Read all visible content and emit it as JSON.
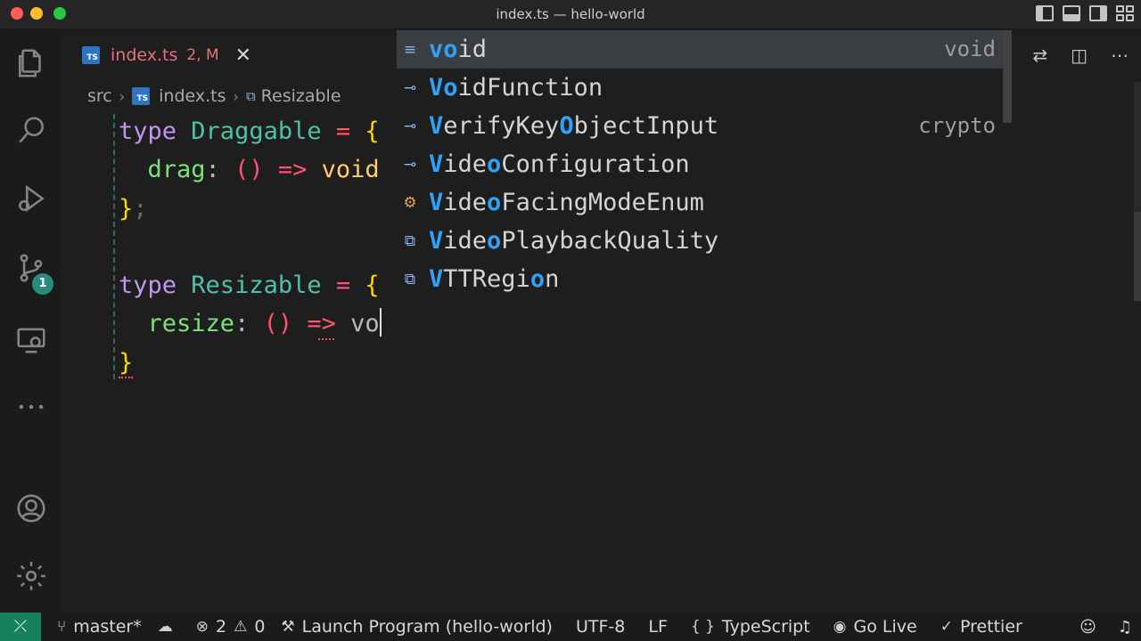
{
  "window": {
    "title": "index.ts — hello-world"
  },
  "tab": {
    "filename": "index.ts",
    "status": "2, M",
    "close_glyph": "✕",
    "icon_text": "TS"
  },
  "breadcrumb": {
    "folder": "src",
    "file": "index.ts",
    "symbol": "Resizable",
    "file_icon_text": "TS"
  },
  "activity": {
    "source_control_badge": "1"
  },
  "code": {
    "line1": {
      "kw": "type",
      "name": "Draggable",
      "eq": "=",
      "brace": "{"
    },
    "line2": {
      "prop": "drag",
      "colon": ":",
      "parens": "()",
      "arrow": "=>",
      "ret": "void"
    },
    "line3": {
      "brace": "}",
      "semi": ";"
    },
    "line5": {
      "kw": "type",
      "name": "Resizable",
      "eq": "=",
      "brace": "{"
    },
    "line6": {
      "prop": "resize",
      "colon": ":",
      "parens": "()",
      "arrow": "=>",
      "typed": "vo"
    },
    "line7": {
      "brace": "}"
    }
  },
  "suggestions": [
    {
      "hl1": "vo",
      "rest": "id",
      "detail": "void",
      "icon": "keyword-icon",
      "glyph": "≡"
    },
    {
      "hl1": "Vo",
      "rest": "idFunction",
      "detail": "",
      "icon": "interface-icon",
      "glyph": "⊸"
    },
    {
      "pre": "",
      "hl1": "V",
      "mid": "erifyKey",
      "hl2": "O",
      "rest": "bjectInput",
      "detail": "crypto",
      "icon": "interface-icon",
      "glyph": "⊸"
    },
    {
      "hl1": "V",
      "mid": "ide",
      "hl2": "o",
      "rest": "Configuration",
      "detail": "",
      "icon": "interface-icon",
      "glyph": "⊸"
    },
    {
      "hl1": "V",
      "mid": "ide",
      "hl2": "o",
      "rest": "FacingModeEnum",
      "detail": "",
      "icon": "type-alias-icon",
      "glyph": "⚙"
    },
    {
      "hl1": "V",
      "mid": "ide",
      "hl2": "o",
      "rest": "PlaybackQuality",
      "detail": "",
      "icon": "variable-icon",
      "glyph": "⧉"
    },
    {
      "hl1": "V",
      "mid": "TTRegi",
      "hl2": "o",
      "rest": "n",
      "detail": "",
      "icon": "variable-icon",
      "glyph": "⧉"
    }
  ],
  "statusbar": {
    "remote_glyph": "⤫",
    "branch": "master*",
    "errors": "2",
    "warnings": "0",
    "launch": "Launch Program (hello-world)",
    "encoding": "UTF-8",
    "eol": "LF",
    "language_braces": "{ }",
    "language": "TypeScript",
    "go_live": "Go Live",
    "prettier": "Prettier"
  },
  "colors": {
    "accent_remote": "#16825d",
    "tab_modified": "#e8707a",
    "match_highlight": "#2ea2f8"
  }
}
